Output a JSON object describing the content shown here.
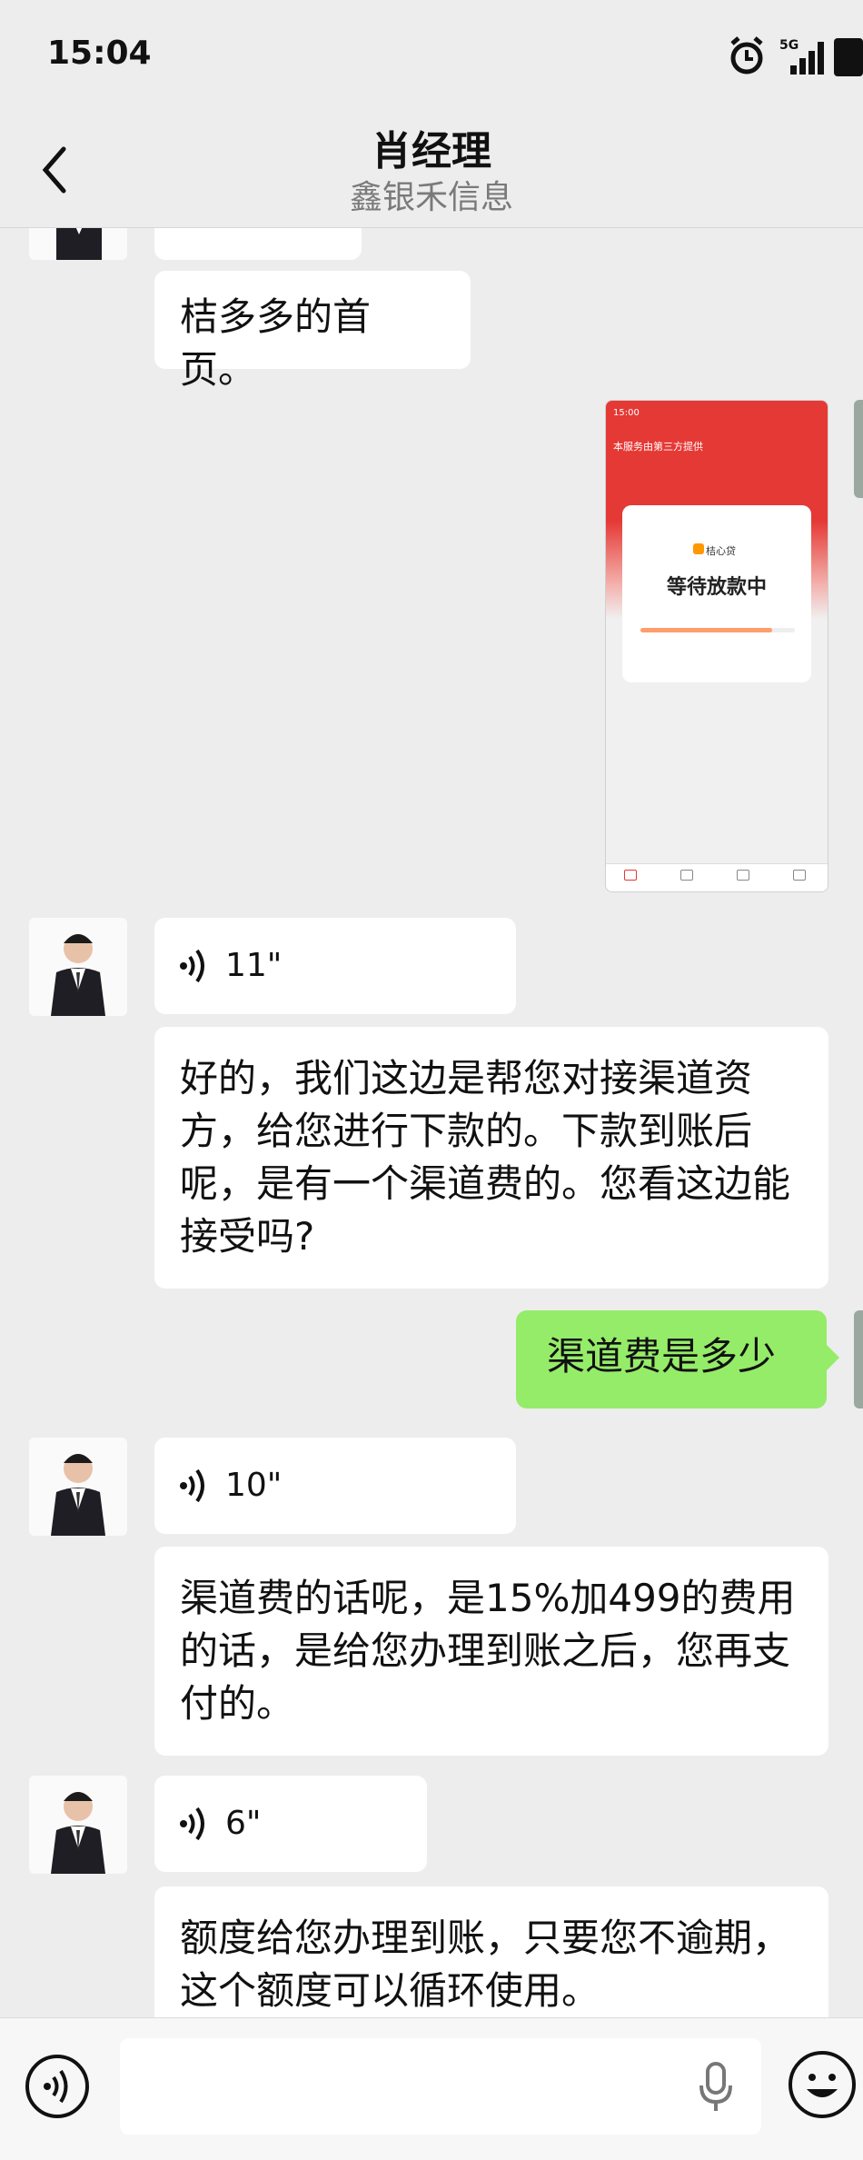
{
  "status_bar": {
    "time": "15:04",
    "network": "5G"
  },
  "header": {
    "title": "肖经理",
    "subtitle": "鑫银禾信息"
  },
  "messages": {
    "m1_text": "桔多多的首页。",
    "voice1": "11\"",
    "m2_text": "好的，我们这边是帮您对接渠道资方，给您进行下款的。下款到账后呢，是有一个渠道费的。您看这边能接受吗?",
    "mine1": "渠道费是多少",
    "voice2": "10\"",
    "m3_text": "渠道费的话呢，是15%加499的费用的话，是给您办理到账之后，您再支付的。",
    "voice3": "6\"",
    "m4_text": "额度给您办理到账，只要您不逾期，这个额度可以循环使用。"
  },
  "screenshot": {
    "status_text": "等待放款中",
    "brand": "桔心贷",
    "header_line": "本服务由第三方提供"
  },
  "colors": {
    "my_bubble": "#95ec69",
    "their_bubble": "#ffffff",
    "background": "#ededed"
  }
}
